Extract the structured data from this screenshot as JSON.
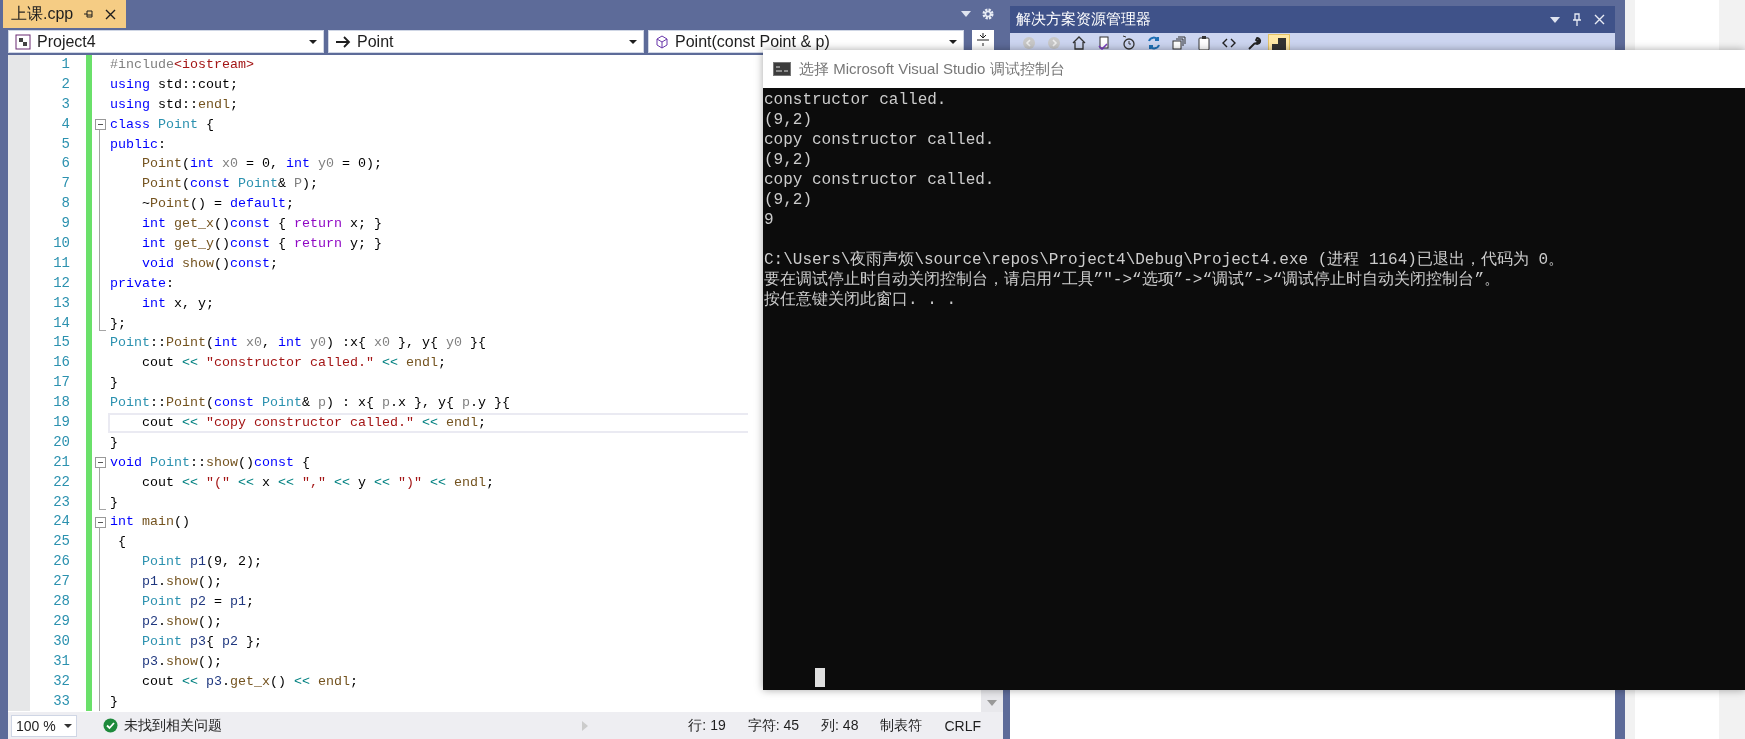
{
  "tabs": [
    {
      "label": "上课.cpp",
      "selected": true,
      "pinned": false
    }
  ],
  "nav_bar": [
    {
      "kind": "project",
      "text": "Project4"
    },
    {
      "kind": "arrow",
      "text": "Point"
    },
    {
      "kind": "method",
      "text": "Point(const Point & p)"
    }
  ],
  "editor": {
    "lines": [
      {
        "number": "1",
        "kind": "plain",
        "changed": true,
        "current": false,
        "tokens": [
          {
            "kind": "pre",
            "text": "#include"
          },
          {
            "kind": "str",
            "text": "<iostream>"
          }
        ]
      },
      {
        "number": "2",
        "kind": "plain",
        "changed": true,
        "current": false,
        "tokens": [
          {
            "kind": "kw",
            "text": "using"
          },
          {
            "kind": "plain",
            "text": " std::cout;"
          }
        ]
      },
      {
        "number": "3",
        "kind": "plain",
        "changed": true,
        "current": false,
        "tokens": [
          {
            "kind": "kw",
            "text": "using"
          },
          {
            "kind": "plain",
            "text": " std::"
          },
          {
            "kind": "fn",
            "text": "endl"
          },
          {
            "kind": "plain",
            "text": ";"
          }
        ]
      },
      {
        "number": "4",
        "kind": "block-start",
        "changed": true,
        "current": false,
        "tokens": [
          {
            "kind": "kw",
            "text": "class"
          },
          {
            "kind": "type",
            "text": " Point"
          },
          {
            "kind": "plain",
            "text": " {"
          }
        ]
      },
      {
        "number": "5",
        "kind": "block-body",
        "changed": true,
        "current": false,
        "tokens": [
          {
            "kind": "kw",
            "text": "public"
          },
          {
            "kind": "plain",
            "text": ":"
          }
        ]
      },
      {
        "number": "6",
        "kind": "block-body",
        "changed": true,
        "current": false,
        "tokens": [
          {
            "kind": "fn",
            "text": "    Point"
          },
          {
            "kind": "plain",
            "text": "("
          },
          {
            "kind": "kw",
            "text": "int"
          },
          {
            "kind": "param",
            "text": " x0"
          },
          {
            "kind": "plain",
            "text": " = 0, "
          },
          {
            "kind": "kw",
            "text": "int"
          },
          {
            "kind": "param",
            "text": " y0"
          },
          {
            "kind": "plain",
            "text": " = 0);"
          }
        ]
      },
      {
        "number": "7",
        "kind": "block-body",
        "changed": true,
        "current": false,
        "tokens": [
          {
            "kind": "fn",
            "text": "    Point"
          },
          {
            "kind": "plain",
            "text": "("
          },
          {
            "kind": "kw",
            "text": "const"
          },
          {
            "kind": "type",
            "text": " Point"
          },
          {
            "kind": "plain",
            "text": "& "
          },
          {
            "kind": "param",
            "text": "P"
          },
          {
            "kind": "plain",
            "text": ");"
          }
        ]
      },
      {
        "number": "8",
        "kind": "block-body",
        "changed": true,
        "current": false,
        "tokens": [
          {
            "kind": "plain",
            "text": "    ~"
          },
          {
            "kind": "fn",
            "text": "Point"
          },
          {
            "kind": "plain",
            "text": "() = "
          },
          {
            "kind": "kw",
            "text": "default"
          },
          {
            "kind": "plain",
            "text": ";"
          }
        ]
      },
      {
        "number": "9",
        "kind": "block-body",
        "changed": true,
        "current": false,
        "tokens": [
          {
            "kind": "kw",
            "text": "    int"
          },
          {
            "kind": "fn",
            "text": " get_x"
          },
          {
            "kind": "plain",
            "text": "()"
          },
          {
            "kind": "kw",
            "text": "const"
          },
          {
            "kind": "plain",
            "text": " { "
          },
          {
            "kind": "ret",
            "text": "return"
          },
          {
            "kind": "plain",
            "text": " x; }"
          }
        ]
      },
      {
        "number": "10",
        "kind": "block-body",
        "changed": true,
        "current": false,
        "tokens": [
          {
            "kind": "kw",
            "text": "    int"
          },
          {
            "kind": "fn",
            "text": " get_y"
          },
          {
            "kind": "plain",
            "text": "()"
          },
          {
            "kind": "kw",
            "text": "const"
          },
          {
            "kind": "plain",
            "text": " { "
          },
          {
            "kind": "ret",
            "text": "return"
          },
          {
            "kind": "plain",
            "text": " y; }"
          }
        ]
      },
      {
        "number": "11",
        "kind": "block-body",
        "changed": true,
        "current": false,
        "tokens": [
          {
            "kind": "kw",
            "text": "    void"
          },
          {
            "kind": "fn",
            "text": " show"
          },
          {
            "kind": "plain",
            "text": "()"
          },
          {
            "kind": "kw",
            "text": "const"
          },
          {
            "kind": "plain",
            "text": ";"
          }
        ]
      },
      {
        "number": "12",
        "kind": "block-body",
        "changed": true,
        "current": false,
        "tokens": [
          {
            "kind": "kw",
            "text": "private"
          },
          {
            "kind": "plain",
            "text": ":"
          }
        ]
      },
      {
        "number": "13",
        "kind": "block-body",
        "changed": true,
        "current": false,
        "tokens": [
          {
            "kind": "kw",
            "text": "    int"
          },
          {
            "kind": "plain",
            "text": " x, y;"
          }
        ]
      },
      {
        "number": "14",
        "kind": "block-end",
        "changed": true,
        "current": false,
        "tokens": [
          {
            "kind": "plain",
            "text": "};"
          }
        ]
      },
      {
        "number": "15",
        "kind": "plain",
        "changed": true,
        "current": false,
        "tokens": [
          {
            "kind": "type",
            "text": "Point"
          },
          {
            "kind": "plain",
            "text": "::"
          },
          {
            "kind": "fn",
            "text": "Point"
          },
          {
            "kind": "plain",
            "text": "("
          },
          {
            "kind": "kw",
            "text": "int"
          },
          {
            "kind": "param",
            "text": " x0"
          },
          {
            "kind": "plain",
            "text": ", "
          },
          {
            "kind": "kw",
            "text": "int"
          },
          {
            "kind": "param",
            "text": " y0"
          },
          {
            "kind": "plain",
            "text": ") :x{ "
          },
          {
            "kind": "param",
            "text": "x0"
          },
          {
            "kind": "plain",
            "text": " }, y{ "
          },
          {
            "kind": "param",
            "text": "y0"
          },
          {
            "kind": "plain",
            "text": " }{"
          }
        ]
      },
      {
        "number": "16",
        "kind": "plain",
        "changed": true,
        "current": false,
        "tokens": [
          {
            "kind": "plain",
            "text": "    cout "
          },
          {
            "kind": "op",
            "text": "<<"
          },
          {
            "kind": "str",
            "text": " \"constructor called.\""
          },
          {
            "kind": "op",
            "text": " <<"
          },
          {
            "kind": "fn",
            "text": " endl"
          },
          {
            "kind": "plain",
            "text": ";"
          }
        ]
      },
      {
        "number": "17",
        "kind": "plain",
        "changed": true,
        "current": false,
        "tokens": [
          {
            "kind": "plain",
            "text": "}"
          }
        ]
      },
      {
        "number": "18",
        "kind": "plain",
        "changed": true,
        "current": false,
        "tokens": [
          {
            "kind": "type",
            "text": "Point"
          },
          {
            "kind": "plain",
            "text": "::"
          },
          {
            "kind": "fn",
            "text": "Point"
          },
          {
            "kind": "plain",
            "text": "("
          },
          {
            "kind": "kw",
            "text": "const"
          },
          {
            "kind": "type",
            "text": " Point"
          },
          {
            "kind": "plain",
            "text": "& "
          },
          {
            "kind": "param",
            "text": "p"
          },
          {
            "kind": "plain",
            "text": ") : x{ "
          },
          {
            "kind": "param",
            "text": "p"
          },
          {
            "kind": "plain",
            "text": ".x }, y{ "
          },
          {
            "kind": "param",
            "text": "p"
          },
          {
            "kind": "plain",
            "text": ".y }{"
          }
        ]
      },
      {
        "number": "19",
        "kind": "plain",
        "changed": true,
        "current": true,
        "tokens": [
          {
            "kind": "plain",
            "text": "    cout "
          },
          {
            "kind": "op",
            "text": "<<"
          },
          {
            "kind": "str",
            "text": " \"copy constructor called.\""
          },
          {
            "kind": "op",
            "text": " <<"
          },
          {
            "kind": "fn",
            "text": " endl"
          },
          {
            "kind": "plain",
            "text": ";"
          }
        ]
      },
      {
        "number": "20",
        "kind": "plain",
        "changed": true,
        "current": false,
        "tokens": [
          {
            "kind": "plain",
            "text": "}"
          }
        ]
      },
      {
        "number": "21",
        "kind": "block-start",
        "changed": true,
        "current": false,
        "tokens": [
          {
            "kind": "kw",
            "text": "void"
          },
          {
            "kind": "type",
            "text": " Point"
          },
          {
            "kind": "plain",
            "text": "::"
          },
          {
            "kind": "fn",
            "text": "show"
          },
          {
            "kind": "plain",
            "text": "()"
          },
          {
            "kind": "kw",
            "text": "const"
          },
          {
            "kind": "plain",
            "text": " {"
          }
        ]
      },
      {
        "number": "22",
        "kind": "block-body",
        "changed": true,
        "current": false,
        "tokens": [
          {
            "kind": "plain",
            "text": "    cout "
          },
          {
            "kind": "op",
            "text": "<<"
          },
          {
            "kind": "str",
            "text": " \"(\""
          },
          {
            "kind": "op",
            "text": " <<"
          },
          {
            "kind": "plain",
            "text": " x "
          },
          {
            "kind": "op",
            "text": "<<"
          },
          {
            "kind": "str",
            "text": " \",\""
          },
          {
            "kind": "op",
            "text": " <<"
          },
          {
            "kind": "plain",
            "text": " y "
          },
          {
            "kind": "op",
            "text": "<<"
          },
          {
            "kind": "str",
            "text": " \")\""
          },
          {
            "kind": "op",
            "text": " <<"
          },
          {
            "kind": "fn",
            "text": " endl"
          },
          {
            "kind": "plain",
            "text": ";"
          }
        ]
      },
      {
        "number": "23",
        "kind": "block-end",
        "changed": true,
        "current": false,
        "tokens": [
          {
            "kind": "plain",
            "text": "}"
          }
        ]
      },
      {
        "number": "24",
        "kind": "block-start",
        "changed": true,
        "current": false,
        "tokens": [
          {
            "kind": "kw",
            "text": "int"
          },
          {
            "kind": "fn",
            "text": " main"
          },
          {
            "kind": "plain",
            "text": "()"
          }
        ]
      },
      {
        "number": "25",
        "kind": "block-body",
        "changed": true,
        "current": false,
        "tokens": [
          {
            "kind": "plain",
            "text": " {"
          }
        ]
      },
      {
        "number": "26",
        "kind": "block-body",
        "changed": true,
        "current": false,
        "tokens": [
          {
            "kind": "type",
            "text": "    Point"
          },
          {
            "kind": "local",
            "text": " p1"
          },
          {
            "kind": "plain",
            "text": "(9, 2);"
          }
        ]
      },
      {
        "number": "27",
        "kind": "block-body",
        "changed": true,
        "current": false,
        "tokens": [
          {
            "kind": "local",
            "text": "    p1"
          },
          {
            "kind": "plain",
            "text": "."
          },
          {
            "kind": "fn",
            "text": "show"
          },
          {
            "kind": "plain",
            "text": "();"
          }
        ]
      },
      {
        "number": "28",
        "kind": "block-body",
        "changed": true,
        "current": false,
        "tokens": [
          {
            "kind": "type",
            "text": "    Point"
          },
          {
            "kind": "local",
            "text": " p2"
          },
          {
            "kind": "plain",
            "text": " = "
          },
          {
            "kind": "local",
            "text": "p1"
          },
          {
            "kind": "plain",
            "text": ";"
          }
        ]
      },
      {
        "number": "29",
        "kind": "block-body",
        "changed": true,
        "current": false,
        "tokens": [
          {
            "kind": "local",
            "text": "    p2"
          },
          {
            "kind": "plain",
            "text": "."
          },
          {
            "kind": "fn",
            "text": "show"
          },
          {
            "kind": "plain",
            "text": "();"
          }
        ]
      },
      {
        "number": "30",
        "kind": "block-body",
        "changed": true,
        "current": false,
        "tokens": [
          {
            "kind": "type",
            "text": "    Point"
          },
          {
            "kind": "local",
            "text": " p3"
          },
          {
            "kind": "plain",
            "text": "{ "
          },
          {
            "kind": "local",
            "text": "p2"
          },
          {
            "kind": "plain",
            "text": " };"
          }
        ]
      },
      {
        "number": "31",
        "kind": "block-body",
        "changed": true,
        "current": false,
        "tokens": [
          {
            "kind": "local",
            "text": "    p3"
          },
          {
            "kind": "plain",
            "text": "."
          },
          {
            "kind": "fn",
            "text": "show"
          },
          {
            "kind": "plain",
            "text": "();"
          }
        ]
      },
      {
        "number": "32",
        "kind": "block-body",
        "changed": true,
        "current": false,
        "tokens": [
          {
            "kind": "plain",
            "text": "    cout "
          },
          {
            "kind": "op",
            "text": "<<"
          },
          {
            "kind": "local",
            "text": " p3"
          },
          {
            "kind": "plain",
            "text": "."
          },
          {
            "kind": "fn",
            "text": "get_x"
          },
          {
            "kind": "plain",
            "text": "() "
          },
          {
            "kind": "op",
            "text": "<<"
          },
          {
            "kind": "fn",
            "text": " endl"
          },
          {
            "kind": "plain",
            "text": ";"
          }
        ]
      },
      {
        "number": "33",
        "kind": "block-body",
        "changed": true,
        "current": false,
        "tokens": [
          {
            "kind": "plain",
            "text": "}"
          }
        ]
      }
    ]
  },
  "status_bar": {
    "zoom": "100 %",
    "issues": "未找到相关问题",
    "line": "行: 19",
    "char": "字符: 45",
    "column": "列: 48",
    "indent": "制表符",
    "line_ending": "CRLF"
  },
  "solution_explorer": {
    "title": "解决方案资源管理器",
    "toolbar": [
      {
        "kind": "back",
        "selected": false
      },
      {
        "kind": "forward",
        "selected": false
      },
      {
        "kind": "home",
        "selected": false
      },
      {
        "kind": "switch",
        "selected": false
      },
      {
        "kind": "history",
        "selected": false
      },
      {
        "kind": "sync",
        "selected": false
      },
      {
        "kind": "collapse",
        "selected": false
      },
      {
        "kind": "pages",
        "selected": false
      },
      {
        "kind": "code",
        "selected": false
      },
      {
        "kind": "wrench",
        "selected": false
      },
      {
        "kind": "preview",
        "selected": true
      }
    ]
  },
  "console": {
    "title": "选择 Microsoft Visual Studio 调试控制台",
    "output": [
      "constructor called.",
      "(9,2)",
      "copy constructor called.",
      "(9,2)",
      "copy constructor called.",
      "(9,2)",
      "9"
    ],
    "exit_message": [
      "C:\\Users\\夜雨声烦\\source\\repos\\Project4\\Debug\\Project4.exe (进程 1164)已退出，代码为 0。",
      "要在调试停止时自动关闭控制台，请启用“工具”\"->“选项”->“调试”->“调试停止时自动关闭控制台”。",
      "按任意键关闭此窗口. . ."
    ]
  }
}
